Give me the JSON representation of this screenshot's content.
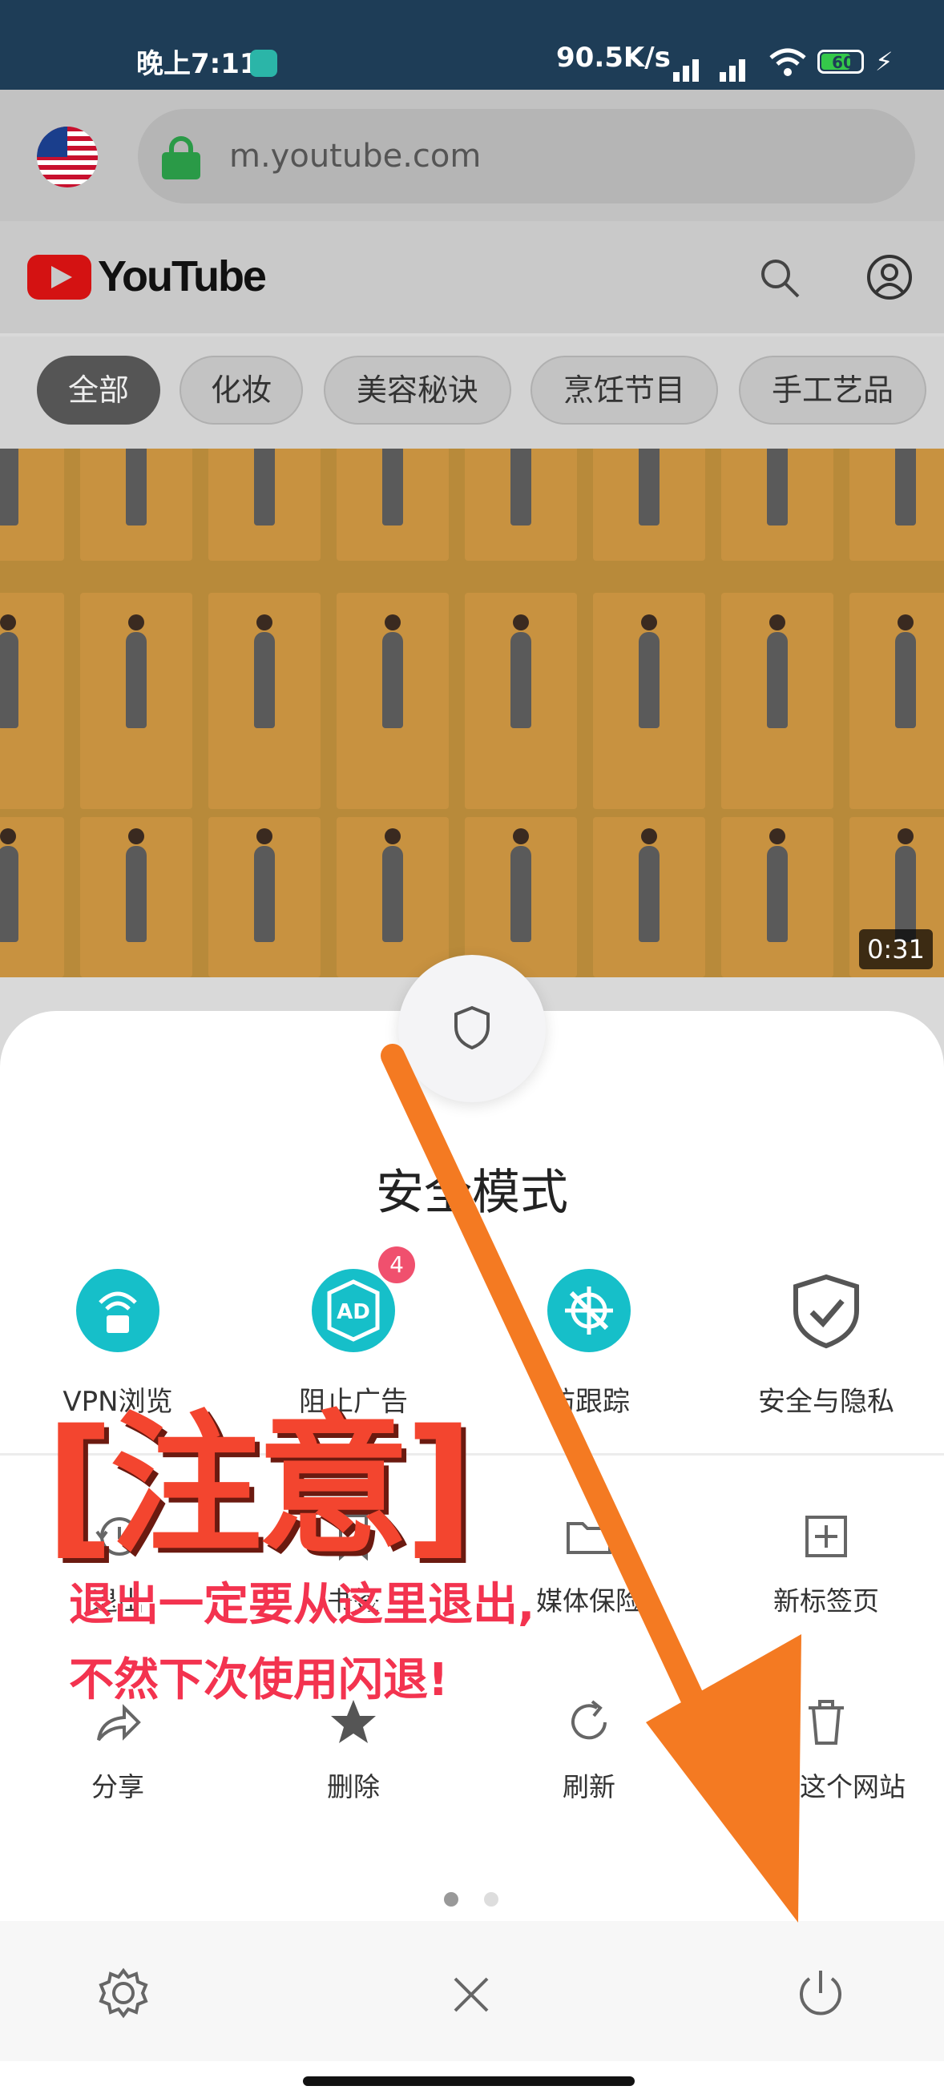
{
  "status_bar": {
    "time": "晚上7:11",
    "network_speed": "90.5K/s",
    "battery": "60"
  },
  "browser": {
    "url": "m.youtube.com"
  },
  "youtube": {
    "wordmark": "YouTube",
    "chips": [
      "全部",
      "化妆",
      "美容秘诀",
      "烹饪节目",
      "手工艺品"
    ],
    "video_duration": "0:31"
  },
  "sheet": {
    "title": "安全模式",
    "features": [
      {
        "label": "VPN浏览",
        "icon": "wifi-lock-icon"
      },
      {
        "label": "阻止广告",
        "icon": "ad-block-icon",
        "badge": "4"
      },
      {
        "label": "防跟踪",
        "icon": "anti-tracking-icon"
      },
      {
        "label": "安全与隐私",
        "icon": "shield-check-icon"
      }
    ],
    "grid_row1": [
      {
        "label": "退出",
        "icon": "history-icon"
      },
      {
        "label": "书签",
        "icon": "bookmark-icon"
      },
      {
        "label": "媒体保险",
        "icon": "folder-icon"
      },
      {
        "label": "新标签页",
        "icon": "new-tab-icon"
      }
    ],
    "grid_row2": [
      {
        "label": "分享",
        "icon": "share-icon"
      },
      {
        "label": "删除",
        "icon": "star-icon"
      },
      {
        "label": "刷新",
        "icon": "refresh-icon"
      },
      {
        "label": "关闭这个网站",
        "icon": "trash-icon"
      }
    ],
    "page_dots": 2,
    "active_dot": 0
  },
  "bottom_bar": {
    "icons": [
      "gear-icon",
      "close-icon",
      "power-icon"
    ]
  },
  "annotation": {
    "title": "[注意]",
    "line1": "退出一定要从这里退出,",
    "line2": "不然下次使用闪退!",
    "arrow_color": "#f47a22"
  }
}
